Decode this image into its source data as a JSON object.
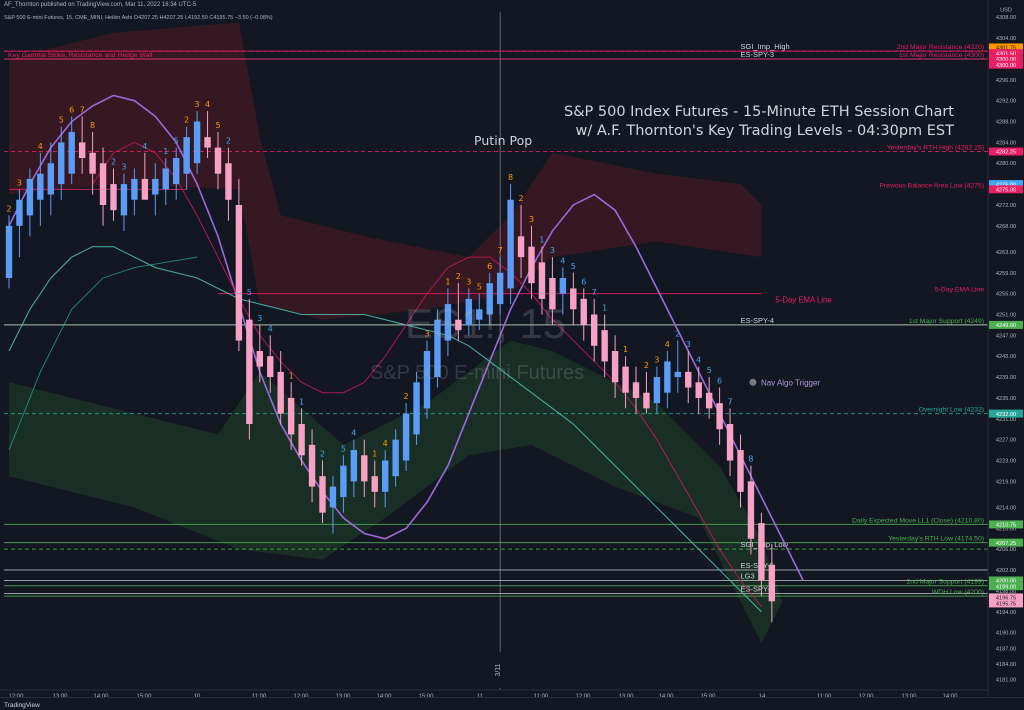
{
  "header": {
    "publisher": "AF_Thornton published on TradingView.com, Mar 11, 2022 16:34 UTC-5",
    "symbol_line": "S&P 500 E-mini Futures, 15, CME_MINI, Heikin Ashi  O4207.25  H4207.25  L4192.50  C4195.75  −3.50 (−0.08%)"
  },
  "annotation": {
    "title_line1": "S&P 500 Index Futures - 15-Minute ETH Session Chart",
    "title_line2": "w/ A.F. Thornton's Key Trading Levels - 04:30pm EST",
    "putin": "Putin Pop",
    "nav_algo": "Nav Algo Trigger",
    "ema_label": "5-Day EMA Line",
    "gamma_label": "Key Gamma Strike, Resistance and Hedge Wall"
  },
  "watermark": {
    "symbol": "ES1!, 15",
    "name": "S&P 500 E-mini Futures"
  },
  "footer": {
    "logo": "TradingView"
  },
  "colors": {
    "bg": "#131722",
    "up": "#5b9cf6",
    "down": "#f7a1c4",
    "magenta": "#e91e63",
    "teal": "#26a69a",
    "green": "#4caf50",
    "purple": "#9c6ade",
    "orange": "#ff9800",
    "blue_num": "#42a5f5"
  },
  "chart_data": {
    "type": "candlestick",
    "candle_style": "Heikin Ashi",
    "timeframe": "15",
    "ylabel": "USD",
    "ylim": [
      4179,
      4309
    ],
    "y_ticks": [
      4308,
      4304,
      4300,
      4296,
      4292,
      4288,
      4284,
      4280,
      4276,
      4272,
      4268,
      4263,
      4259,
      4255,
      4251,
      4247,
      4243,
      4239,
      4235,
      4231,
      4227,
      4223,
      4219,
      4214,
      4210,
      4206,
      4202,
      4198,
      4194,
      4190,
      4187,
      4184,
      4181
    ],
    "y_tick_labels": [
      "4308.00",
      "4304.00",
      "4300.00",
      "4296.00",
      "4292.00",
      "4288.00",
      "4284.00",
      "4280.00",
      "4276.00",
      "4272.00",
      "4268.00",
      "4263.00",
      "4259.00",
      "4255.00",
      "4251.00",
      "4247.00",
      "4243.00",
      "4239.00",
      "4235.00",
      "4231.00",
      "4227.00",
      "4223.00",
      "4219.00",
      "4214.00",
      "4210.00",
      "4206.00",
      "4202.00",
      "4198.00",
      "4194.00",
      "4190.00",
      "4187.00",
      "4184.00",
      "4181.00"
    ],
    "x_labels": [
      "12:00",
      "13:00",
      "14:00",
      "15:00",
      "10",
      "11:00",
      "12:00",
      "13:00",
      "14:00",
      "15:00",
      "11",
      "11:00",
      "12:00",
      "13:00",
      "14:00",
      "15:00",
      "14",
      "11:00",
      "12:00",
      "13:00",
      "14:00"
    ],
    "session_marker": "3/11",
    "levels": [
      {
        "label": "SGI_Imp_High",
        "value": 4301.5,
        "color": "#e91e63"
      },
      {
        "label": "2nd Major Resistance (4320)",
        "value": 4301.5,
        "color": "#e91e63",
        "style": "dashed"
      },
      {
        "label": "1st Major Resistance (4300)",
        "value": 4300.0,
        "color": "#e91e63"
      },
      {
        "label": "ES-SPY-3",
        "value": 4300.0,
        "color": "#b2b5be"
      },
      {
        "label": "Key Gamma Strike, Resistance and Hedge Wall",
        "value": 4300.0,
        "color": "#e91e63"
      },
      {
        "label": "Yesterday's RTH High (4282.25)",
        "value": 4282.25,
        "color": "#e91e63",
        "style": "dashed"
      },
      {
        "label": "Previous Balance Area Low (4275)",
        "value": 4275.0,
        "color": "#e91e63"
      },
      {
        "label": "5-Day EMA Line",
        "value": 4255.0,
        "color": "#e91e63"
      },
      {
        "label": "1st Major Support (4249)",
        "value": 4249.0,
        "color": "#4caf50"
      },
      {
        "label": "ES-SPY-4",
        "value": 4249.0,
        "color": "#b2b5be"
      },
      {
        "label": "Overnight Low (4232)",
        "value": 4232.0,
        "color": "#26a69a",
        "style": "dashed"
      },
      {
        "label": "Daily Expected Move LL1 (Close) (4210.80)",
        "value": 4210.75,
        "color": "#4caf50"
      },
      {
        "label": "Yesterday's RTH Low (4174.50)",
        "value": 4207.25,
        "color": "#4caf50"
      },
      {
        "label": "SGI_Imp_Low",
        "value": 4206.0,
        "color": "#4caf50",
        "style": "dashed"
      },
      {
        "label": "ES-SPY-5",
        "value": 4202.0,
        "color": "#b2b5be"
      },
      {
        "label": "LG3",
        "value": 4200.0,
        "color": "#b2b5be"
      },
      {
        "label": "2nd Major Support (4199)",
        "value": 4199.0,
        "color": "#4caf50"
      },
      {
        "label": "ES-SPY-1",
        "value": 4197.5,
        "color": "#b2b5be"
      },
      {
        "label": "WDH Low (4200)",
        "value": 4197.0,
        "color": "#4caf50"
      }
    ],
    "price_tags": [
      {
        "label": "USD",
        "value": 4309.5,
        "color": "#131722",
        "text": "#b2b5be"
      },
      {
        "label": "4301.75",
        "value": 4302.2,
        "color": "#ff9800",
        "text": "#131722"
      },
      {
        "label": "4301.50",
        "value": 4301.1,
        "color": "#e91e63",
        "text": "#ffffff"
      },
      {
        "label": "4300.00",
        "value": 4300.0,
        "color": "#e91e63",
        "text": "#ffffff"
      },
      {
        "label": "4300.00",
        "value": 4298.9,
        "color": "#e91e63",
        "text": "#ffffff"
      },
      {
        "label": "4282.25",
        "value": 4282.25,
        "color": "#e91e63",
        "text": "#ffffff"
      },
      {
        "label": "4276.00",
        "value": 4276.0,
        "color": "#42a5f5",
        "text": "#ffffff"
      },
      {
        "label": "4275.00",
        "value": 4275.0,
        "color": "#e91e63",
        "text": "#ffffff"
      },
      {
        "label": "4249.00",
        "value": 4249.0,
        "color": "#4caf50",
        "text": "#ffffff"
      },
      {
        "label": "4232.00",
        "value": 4232.0,
        "color": "#26a69a",
        "text": "#ffffff"
      },
      {
        "label": "4210.75",
        "value": 4210.75,
        "color": "#4caf50",
        "text": "#ffffff"
      },
      {
        "label": "4207.25",
        "value": 4207.25,
        "color": "#4caf50",
        "text": "#ffffff"
      },
      {
        "label": "4200.00",
        "value": 4200.0,
        "color": "#4caf50",
        "text": "#ffffff"
      },
      {
        "label": "4199.00",
        "value": 4198.9,
        "color": "#4caf50",
        "text": "#ffffff"
      },
      {
        "label": "4196.75",
        "value": 4196.75,
        "color": "#f7a1c4",
        "text": "#131722"
      },
      {
        "label": "4195.75",
        "value": 4195.6,
        "color": "#f7a1c4",
        "text": "#131722"
      }
    ],
    "candles": [
      {
        "o": 4258,
        "h": 4270,
        "l": 4256,
        "c": 4268
      },
      {
        "o": 4268,
        "h": 4275,
        "l": 4262,
        "c": 4273
      },
      {
        "o": 4270,
        "h": 4279,
        "l": 4266,
        "c": 4277
      },
      {
        "o": 4273,
        "h": 4282,
        "l": 4268,
        "c": 4278
      },
      {
        "o": 4274,
        "h": 4284,
        "l": 4270,
        "c": 4280
      },
      {
        "o": 4276,
        "h": 4287,
        "l": 4273,
        "c": 4284
      },
      {
        "o": 4278,
        "h": 4289,
        "l": 4276,
        "c": 4286
      },
      {
        "o": 4284,
        "h": 4289,
        "l": 4278,
        "c": 4281
      },
      {
        "o": 4282,
        "h": 4286,
        "l": 4274,
        "c": 4278
      },
      {
        "o": 4280,
        "h": 4283,
        "l": 4268,
        "c": 4272
      },
      {
        "o": 4276,
        "h": 4279,
        "l": 4269,
        "c": 4271
      },
      {
        "o": 4270,
        "h": 4278,
        "l": 4267,
        "c": 4276
      },
      {
        "o": 4273,
        "h": 4279,
        "l": 4270,
        "c": 4277
      },
      {
        "o": 4277,
        "h": 4282,
        "l": 4274,
        "c": 4273
      },
      {
        "o": 4274,
        "h": 4280,
        "l": 4270,
        "c": 4277
      },
      {
        "o": 4275,
        "h": 4281,
        "l": 4272,
        "c": 4279
      },
      {
        "o": 4276,
        "h": 4283,
        "l": 4273,
        "c": 4281
      },
      {
        "o": 4278,
        "h": 4287,
        "l": 4275,
        "c": 4285
      },
      {
        "o": 4280,
        "h": 4290,
        "l": 4278,
        "c": 4288
      },
      {
        "o": 4285,
        "h": 4290,
        "l": 4281,
        "c": 4283
      },
      {
        "o": 4283,
        "h": 4286,
        "l": 4275,
        "c": 4278
      },
      {
        "o": 4280,
        "h": 4283,
        "l": 4269,
        "c": 4273
      },
      {
        "o": 4272,
        "h": 4277,
        "l": 4244,
        "c": 4246
      },
      {
        "o": 4250,
        "h": 4254,
        "l": 4227,
        "c": 4230
      },
      {
        "o": 4244,
        "h": 4249,
        "l": 4238,
        "c": 4241
      },
      {
        "o": 4243,
        "h": 4247,
        "l": 4236,
        "c": 4239
      },
      {
        "o": 4240,
        "h": 4244,
        "l": 4230,
        "c": 4232
      },
      {
        "o": 4235,
        "h": 4238,
        "l": 4225,
        "c": 4228
      },
      {
        "o": 4230,
        "h": 4233,
        "l": 4222,
        "c": 4224
      },
      {
        "o": 4226,
        "h": 4229,
        "l": 4215,
        "c": 4218
      },
      {
        "o": 4220,
        "h": 4223,
        "l": 4211,
        "c": 4213
      },
      {
        "o": 4214,
        "h": 4220,
        "l": 4209,
        "c": 4218
      },
      {
        "o": 4216,
        "h": 4224,
        "l": 4213,
        "c": 4222
      },
      {
        "o": 4219,
        "h": 4227,
        "l": 4216,
        "c": 4225
      },
      {
        "o": 4224,
        "h": 4227,
        "l": 4216,
        "c": 4219
      },
      {
        "o": 4220,
        "h": 4223,
        "l": 4214,
        "c": 4217
      },
      {
        "o": 4217,
        "h": 4225,
        "l": 4214,
        "c": 4223
      },
      {
        "o": 4220,
        "h": 4229,
        "l": 4218,
        "c": 4227
      },
      {
        "o": 4223,
        "h": 4234,
        "l": 4221,
        "c": 4232
      },
      {
        "o": 4228,
        "h": 4240,
        "l": 4226,
        "c": 4238
      },
      {
        "o": 4233,
        "h": 4246,
        "l": 4231,
        "c": 4244
      },
      {
        "o": 4239,
        "h": 4252,
        "l": 4237,
        "c": 4250
      },
      {
        "o": 4246,
        "h": 4256,
        "l": 4243,
        "c": 4253
      },
      {
        "o": 4250,
        "h": 4257,
        "l": 4246,
        "c": 4248
      },
      {
        "o": 4249,
        "h": 4256,
        "l": 4247,
        "c": 4254
      },
      {
        "o": 4250,
        "h": 4255,
        "l": 4248,
        "c": 4252
      },
      {
        "o": 4251,
        "h": 4259,
        "l": 4249,
        "c": 4257
      },
      {
        "o": 4253,
        "h": 4262,
        "l": 4251,
        "c": 4259
      },
      {
        "o": 4256,
        "h": 4276,
        "l": 4253,
        "c": 4273
      },
      {
        "o": 4266,
        "h": 4272,
        "l": 4258,
        "c": 4262
      },
      {
        "o": 4264,
        "h": 4268,
        "l": 4254,
        "c": 4257
      },
      {
        "o": 4261,
        "h": 4264,
        "l": 4251,
        "c": 4254
      },
      {
        "o": 4258,
        "h": 4262,
        "l": 4249,
        "c": 4252
      },
      {
        "o": 4255,
        "h": 4260,
        "l": 4251,
        "c": 4258
      },
      {
        "o": 4256,
        "h": 4259,
        "l": 4249,
        "c": 4252
      },
      {
        "o": 4254,
        "h": 4256,
        "l": 4246,
        "c": 4249
      },
      {
        "o": 4251,
        "h": 4254,
        "l": 4242,
        "c": 4245
      },
      {
        "o": 4248,
        "h": 4251,
        "l": 4239,
        "c": 4242
      },
      {
        "o": 4244,
        "h": 4247,
        "l": 4235,
        "c": 4238
      },
      {
        "o": 4241,
        "h": 4243,
        "l": 4233,
        "c": 4236
      },
      {
        "o": 4238,
        "h": 4241,
        "l": 4232,
        "c": 4235
      },
      {
        "o": 4236,
        "h": 4240,
        "l": 4232,
        "c": 4233
      },
      {
        "o": 4234,
        "h": 4241,
        "l": 4232,
        "c": 4239
      },
      {
        "o": 4236,
        "h": 4244,
        "l": 4233,
        "c": 4242
      },
      {
        "o": 4239,
        "h": 4246,
        "l": 4236,
        "c": 4240
      },
      {
        "o": 4240,
        "h": 4244,
        "l": 4234,
        "c": 4237
      },
      {
        "o": 4238,
        "h": 4241,
        "l": 4232,
        "c": 4235
      },
      {
        "o": 4236,
        "h": 4239,
        "l": 4231,
        "c": 4233
      },
      {
        "o": 4234,
        "h": 4237,
        "l": 4226,
        "c": 4229
      },
      {
        "o": 4230,
        "h": 4233,
        "l": 4220,
        "c": 4223
      },
      {
        "o": 4225,
        "h": 4228,
        "l": 4214,
        "c": 4217
      },
      {
        "o": 4219,
        "h": 4222,
        "l": 4205,
        "c": 4208
      },
      {
        "o": 4211,
        "h": 4213,
        "l": 4197,
        "c": 4200
      },
      {
        "o": 4203,
        "h": 4207,
        "l": 4192,
        "c": 4196
      }
    ],
    "markers": [
      {
        "i": 0,
        "t": "2",
        "c": "orange",
        "side": "above"
      },
      {
        "i": 1,
        "t": "3",
        "c": "orange",
        "side": "above"
      },
      {
        "i": 3,
        "t": "4",
        "c": "orange",
        "side": "above"
      },
      {
        "i": 5,
        "t": "5",
        "c": "orange",
        "side": "above"
      },
      {
        "i": 6,
        "t": "6",
        "c": "orange",
        "side": "above"
      },
      {
        "i": 7,
        "t": "7",
        "c": "orange",
        "side": "above"
      },
      {
        "i": 8,
        "t": "8",
        "c": "orange",
        "side": "above"
      },
      {
        "i": 10,
        "t": "2",
        "c": "blue",
        "side": "above"
      },
      {
        "i": 11,
        "t": "3",
        "c": "blue",
        "side": "above"
      },
      {
        "i": 13,
        "t": "4",
        "c": "blue",
        "side": "above"
      },
      {
        "i": 15,
        "t": "1",
        "c": "blue",
        "side": "above"
      },
      {
        "i": 16,
        "t": "5",
        "c": "blue",
        "side": "above"
      },
      {
        "i": 17,
        "t": "2",
        "c": "orange",
        "side": "above"
      },
      {
        "i": 18,
        "t": "3",
        "c": "orange",
        "side": "above"
      },
      {
        "i": 19,
        "t": "4",
        "c": "orange",
        "side": "above"
      },
      {
        "i": 20,
        "t": "5",
        "c": "orange",
        "side": "above"
      },
      {
        "i": 21,
        "t": "2",
        "c": "blue",
        "side": "above"
      },
      {
        "i": 23,
        "t": "5",
        "c": "blue",
        "side": "above"
      },
      {
        "i": 24,
        "t": "3",
        "c": "blue",
        "side": "above"
      },
      {
        "i": 25,
        "t": "4",
        "c": "blue",
        "side": "above"
      },
      {
        "i": 27,
        "t": "1",
        "c": "orange",
        "side": "above"
      },
      {
        "i": 28,
        "t": "1",
        "c": "blue",
        "side": "above"
      },
      {
        "i": 30,
        "t": "2",
        "c": "blue",
        "side": "above"
      },
      {
        "i": 32,
        "t": "5",
        "c": "blue",
        "side": "above"
      },
      {
        "i": 33,
        "t": "4",
        "c": "blue",
        "side": "above"
      },
      {
        "i": 35,
        "t": "1",
        "c": "orange",
        "side": "above"
      },
      {
        "i": 36,
        "t": "4",
        "c": "orange",
        "side": "above"
      },
      {
        "i": 38,
        "t": "2",
        "c": "orange",
        "side": "above"
      },
      {
        "i": 40,
        "t": "3",
        "c": "orange",
        "side": "above"
      },
      {
        "i": 42,
        "t": "1",
        "c": "orange",
        "side": "above"
      },
      {
        "i": 43,
        "t": "2",
        "c": "orange",
        "side": "above"
      },
      {
        "i": 44,
        "t": "3",
        "c": "orange",
        "side": "above"
      },
      {
        "i": 45,
        "t": "5",
        "c": "orange",
        "side": "above"
      },
      {
        "i": 46,
        "t": "6",
        "c": "orange",
        "side": "above"
      },
      {
        "i": 47,
        "t": "7",
        "c": "orange",
        "side": "above"
      },
      {
        "i": 48,
        "t": "8",
        "c": "orange",
        "side": "above"
      },
      {
        "i": 49,
        "t": "2",
        "c": "orange",
        "side": "above"
      },
      {
        "i": 50,
        "t": "3",
        "c": "orange",
        "side": "above"
      },
      {
        "i": 51,
        "t": "1",
        "c": "blue",
        "side": "above"
      },
      {
        "i": 52,
        "t": "3",
        "c": "blue",
        "side": "above"
      },
      {
        "i": 53,
        "t": "4",
        "c": "blue",
        "side": "above"
      },
      {
        "i": 54,
        "t": "5",
        "c": "blue",
        "side": "above"
      },
      {
        "i": 55,
        "t": "6",
        "c": "blue",
        "side": "above"
      },
      {
        "i": 56,
        "t": "7",
        "c": "blue",
        "side": "above"
      },
      {
        "i": 57,
        "t": "1",
        "c": "blue",
        "side": "above"
      },
      {
        "i": 59,
        "t": "1",
        "c": "orange",
        "side": "above"
      },
      {
        "i": 61,
        "t": "2",
        "c": "orange",
        "side": "above"
      },
      {
        "i": 62,
        "t": "3",
        "c": "orange",
        "side": "above"
      },
      {
        "i": 63,
        "t": "4",
        "c": "orange",
        "side": "above"
      },
      {
        "i": 64,
        "t": "2",
        "c": "blue",
        "side": "above"
      },
      {
        "i": 65,
        "t": "3",
        "c": "blue",
        "side": "above"
      },
      {
        "i": 66,
        "t": "4",
        "c": "blue",
        "side": "above"
      },
      {
        "i": 67,
        "t": "5",
        "c": "blue",
        "side": "above"
      },
      {
        "i": 68,
        "t": "6",
        "c": "blue",
        "side": "above"
      },
      {
        "i": 69,
        "t": "7",
        "c": "blue",
        "side": "above"
      },
      {
        "i": 71,
        "t": "8",
        "c": "blue",
        "side": "above"
      }
    ]
  }
}
